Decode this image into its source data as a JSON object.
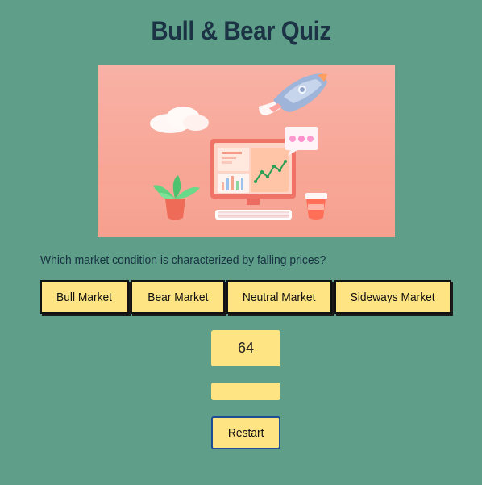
{
  "title": "Bull & Bear Quiz",
  "question": "Which market condition is characterized by falling prices?",
  "answers": [
    "Bull Market",
    "Bear Market",
    "Neutral Market",
    "Sideways Market"
  ],
  "score": "64",
  "feedback": "",
  "restart_label": "Restart",
  "colors": {
    "background": "#5f9f8a",
    "button": "#ffe484",
    "title": "#1b3344",
    "restart_border": "#1f4e96"
  }
}
